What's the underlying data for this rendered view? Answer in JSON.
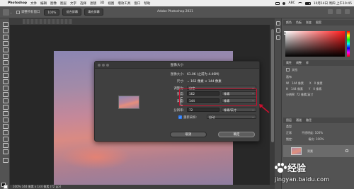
{
  "menubar": {
    "app": "Photoshop",
    "items": [
      "文件",
      "编辑",
      "图像",
      "图层",
      "文字",
      "选择",
      "滤镜",
      "3D",
      "视图",
      "增效工具",
      "窗口",
      "帮助"
    ],
    "input_method": "ABC",
    "clock": "10月14日 周四 上午10:45"
  },
  "optbar": {
    "checkbox_label": "调整所有窗口",
    "zoom": "100%",
    "fit_label": "适合屏幕",
    "fill_label": "填充屏幕",
    "window_title": "Adobe Photoshop 2021"
  },
  "panels": {
    "color_tabs": [
      "颜色",
      "色板",
      "渐变",
      "图案"
    ],
    "props_tabs": [
      "属性",
      "调整",
      "库"
    ],
    "props_heading": "文档",
    "canvas_label": "画布",
    "w_label": "W",
    "w_value": "144 像素",
    "h_label": "H",
    "h_value": "144 像素",
    "x_label": "X",
    "x_value": "0 像素",
    "y_label": "Y",
    "y_value": "0 像素",
    "res_label": "分辨率: 72 像素/英寸",
    "layers_tabs": [
      "图层",
      "通道",
      "路径"
    ],
    "kind_label": "类型",
    "mode_label": "正常",
    "opacity_label": "不透明度: 100%",
    "lock_label": "锁定:",
    "fill_label": "填充: 100%",
    "layer_name": "背景"
  },
  "statusbar": {
    "text": "100% 144 像素 x 144 像素 (72 ppi)"
  },
  "dialog": {
    "title": "图像大小",
    "image_size_label": "图像大小:",
    "image_size_value": "61.0K (之前为 4.46M)",
    "dimensions_label": "尺寸:",
    "dimensions_value": "⌄ 162 像素 × 144 像素",
    "fit_to_label": "调整为:",
    "fit_to_value": "自定",
    "width_label": "宽度:",
    "width_value": "162",
    "width_unit": "像素",
    "height_label": "高度:",
    "height_value": "144",
    "height_unit": "像素",
    "resolution_label": "分辨率:",
    "resolution_value": "72",
    "resolution_unit": "像素/英寸",
    "resample_label": "重新采样:",
    "resample_value": "自动",
    "cancel_label": "取消",
    "ok_label": "确定"
  },
  "watermark": {
    "brand": "经验",
    "url": "jingyan.baidu.com"
  },
  "colors": {
    "annotation": "#c8102e",
    "dialog_bg": "#404040",
    "workspace": "#282828",
    "panel": "#535353"
  }
}
